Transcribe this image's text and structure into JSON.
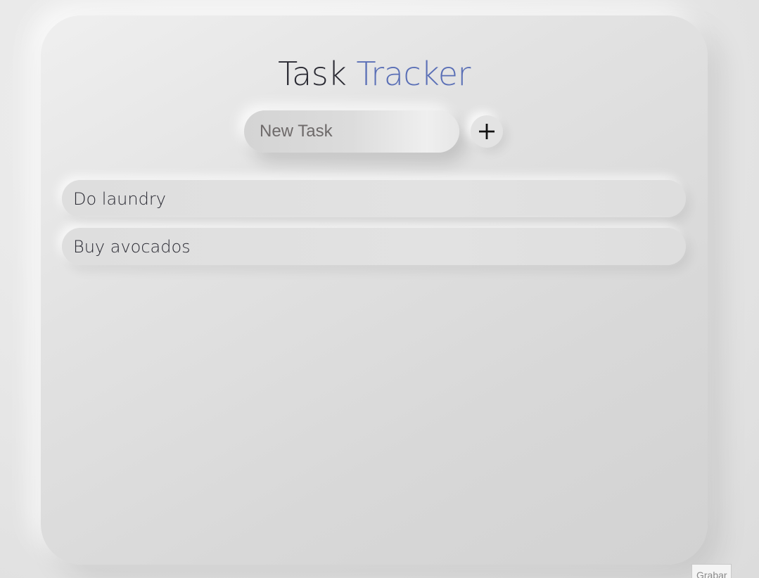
{
  "app": {
    "title_word_1": "Task",
    "title_word_2": "Tracker"
  },
  "colors": {
    "title_dark": "#2a2a33",
    "title_accent": "#5a6fb6"
  },
  "new_task": {
    "placeholder": "New Task",
    "value": "",
    "add_icon": "plus-icon"
  },
  "tasks": [
    {
      "label": "Do laundry"
    },
    {
      "label": "Buy avocados"
    }
  ],
  "corner_button": {
    "label": "Grabar"
  }
}
